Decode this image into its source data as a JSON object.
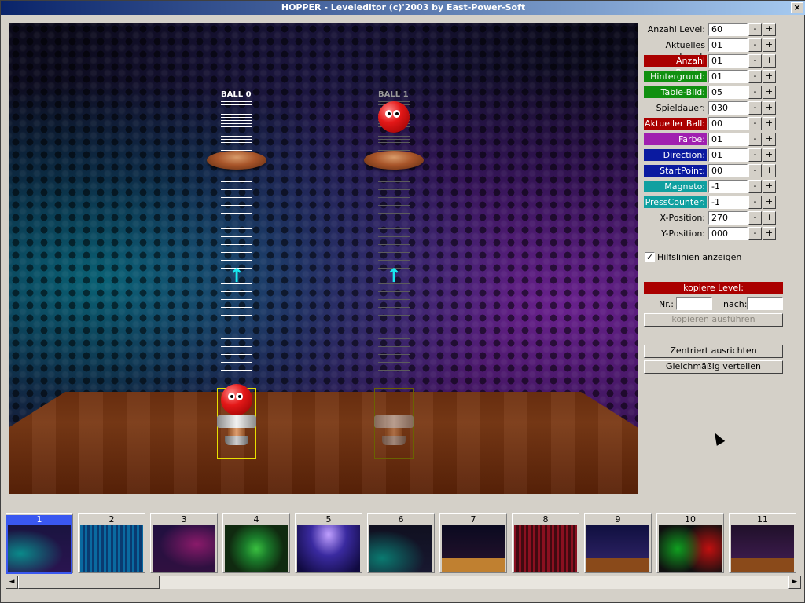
{
  "window": {
    "title": "HOPPER - Leveleditor (c)'2003 by East-Power-Soft",
    "close_label": "×"
  },
  "scene": {
    "tubes": [
      {
        "label": "BALL 0",
        "active": true
      },
      {
        "label": "BALL 1",
        "active": false
      }
    ],
    "arrow_glyph": "↑"
  },
  "settings": [
    {
      "label": "Anzahl Level:",
      "value": "60",
      "color": ""
    },
    {
      "label": "Aktuelles Level:",
      "value": "01",
      "color": ""
    },
    {
      "label": "Anzahl Baelle:",
      "value": "01",
      "color": "#aa0000"
    },
    {
      "label": "Hintergrund:",
      "value": "01",
      "color": "#109010"
    },
    {
      "label": "Table-Bild:",
      "value": "05",
      "color": "#109010"
    },
    {
      "label": "Spieldauer:",
      "value": "030",
      "color": ""
    },
    {
      "label": "Aktueller Ball:",
      "value": "00",
      "color": "#aa0000"
    },
    {
      "label": "Farbe:",
      "value": "01",
      "color": "#a020b0"
    },
    {
      "label": "Direction:",
      "value": "01",
      "color": "#0a1aa0"
    },
    {
      "label": "StartPoint:",
      "value": "00",
      "color": "#0a1aa0"
    },
    {
      "label": "Magneto:",
      "value": "-1",
      "color": "#10a0a0"
    },
    {
      "label": "PressCounter:",
      "value": "-1",
      "color": "#10a0a0"
    },
    {
      "label": "X-Position:",
      "value": "270",
      "color": ""
    },
    {
      "label": "Y-Position:",
      "value": "000",
      "color": ""
    }
  ],
  "spinner": {
    "minus": "-",
    "plus": "+"
  },
  "helper_lines": {
    "label": "Hilfslinien anzeigen",
    "checked_glyph": "✓"
  },
  "copy": {
    "header": "kopiere Level:",
    "nr_label": "Nr.:",
    "to_label": "nach:",
    "execute": "kopieren ausführen"
  },
  "buttons": {
    "center": "Zentriert ausrichten",
    "distribute": "Gleichmäßig verteilen"
  },
  "thumbnails": [
    "1",
    "2",
    "3",
    "4",
    "5",
    "6",
    "7",
    "8",
    "9",
    "10",
    "11"
  ],
  "scroll": {
    "left": "◄",
    "right": "►"
  }
}
